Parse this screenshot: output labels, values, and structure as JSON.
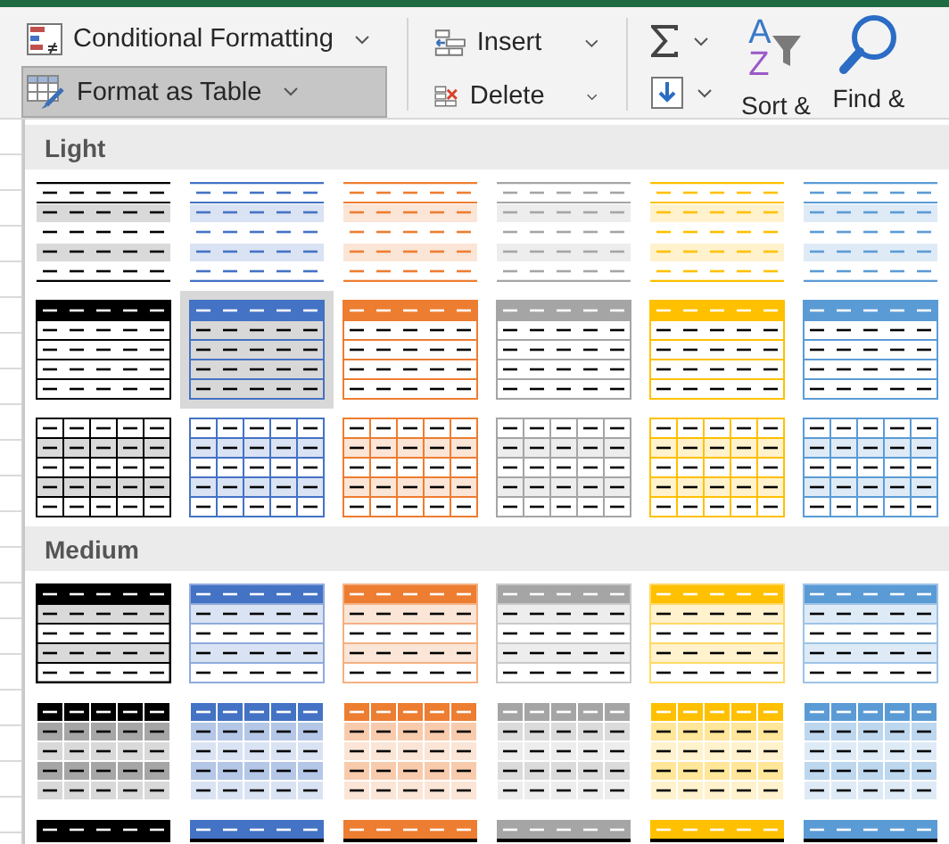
{
  "ribbon": {
    "conditional_formatting": "Conditional Formatting",
    "format_as_table": {
      "label": "Format as Table",
      "pressed": true
    },
    "insert": "Insert",
    "delete": "Delete",
    "sort": {
      "letters": [
        "A",
        "Z"
      ],
      "label": "Sort &"
    },
    "find": "Find &"
  },
  "gallery": {
    "sections": [
      {
        "title": "Light",
        "styles": [
          {
            "kind": "light-banded",
            "color": "#000000",
            "selected": false
          },
          {
            "kind": "light-banded",
            "color": "#4472c4",
            "selected": false
          },
          {
            "kind": "light-banded",
            "color": "#ed7d31",
            "selected": false
          },
          {
            "kind": "light-banded",
            "color": "#a5a5a5",
            "selected": false
          },
          {
            "kind": "light-banded",
            "color": "#ffc000",
            "selected": false
          },
          {
            "kind": "light-banded",
            "color": "#5b9bd5",
            "selected": false
          },
          {
            "kind": "light-header",
            "color": "#000000",
            "selected": false
          },
          {
            "kind": "light-header",
            "color": "#4472c4",
            "selected": true
          },
          {
            "kind": "light-header",
            "color": "#ed7d31",
            "selected": false
          },
          {
            "kind": "light-header",
            "color": "#a5a5a5",
            "selected": false
          },
          {
            "kind": "light-header",
            "color": "#ffc000",
            "selected": false
          },
          {
            "kind": "light-header",
            "color": "#5b9bd5",
            "selected": false
          },
          {
            "kind": "light-grid",
            "color": "#000000",
            "selected": false
          },
          {
            "kind": "light-grid",
            "color": "#4472c4",
            "selected": false
          },
          {
            "kind": "light-grid",
            "color": "#ed7d31",
            "selected": false
          },
          {
            "kind": "light-grid",
            "color": "#a5a5a5",
            "selected": false
          },
          {
            "kind": "light-grid",
            "color": "#ffc000",
            "selected": false
          },
          {
            "kind": "light-grid",
            "color": "#5b9bd5",
            "selected": false
          }
        ]
      },
      {
        "title": "Medium",
        "styles": [
          {
            "kind": "medium-banded",
            "color": "#000000",
            "selected": false
          },
          {
            "kind": "medium-banded",
            "color": "#4472c4",
            "selected": false
          },
          {
            "kind": "medium-banded",
            "color": "#ed7d31",
            "selected": false
          },
          {
            "kind": "medium-banded",
            "color": "#a5a5a5",
            "selected": false
          },
          {
            "kind": "medium-banded",
            "color": "#ffc000",
            "selected": false
          },
          {
            "kind": "medium-banded",
            "color": "#5b9bd5",
            "selected": false
          },
          {
            "kind": "medium-grid",
            "color": "#000000",
            "selected": false
          },
          {
            "kind": "medium-grid",
            "color": "#4472c4",
            "selected": false
          },
          {
            "kind": "medium-grid",
            "color": "#ed7d31",
            "selected": false
          },
          {
            "kind": "medium-grid",
            "color": "#a5a5a5",
            "selected": false
          },
          {
            "kind": "medium-grid",
            "color": "#ffc000",
            "selected": false
          },
          {
            "kind": "medium-grid",
            "color": "#5b9bd5",
            "selected": false
          },
          {
            "kind": "medium-dark",
            "color": "#000000",
            "selected": false
          },
          {
            "kind": "medium-dark",
            "color": "#4472c4",
            "selected": false
          },
          {
            "kind": "medium-dark",
            "color": "#ed7d31",
            "selected": false
          },
          {
            "kind": "medium-dark",
            "color": "#a5a5a5",
            "selected": false
          },
          {
            "kind": "medium-dark",
            "color": "#ffc000",
            "selected": false
          },
          {
            "kind": "medium-dark",
            "color": "#5b9bd5",
            "selected": false
          }
        ]
      }
    ]
  }
}
